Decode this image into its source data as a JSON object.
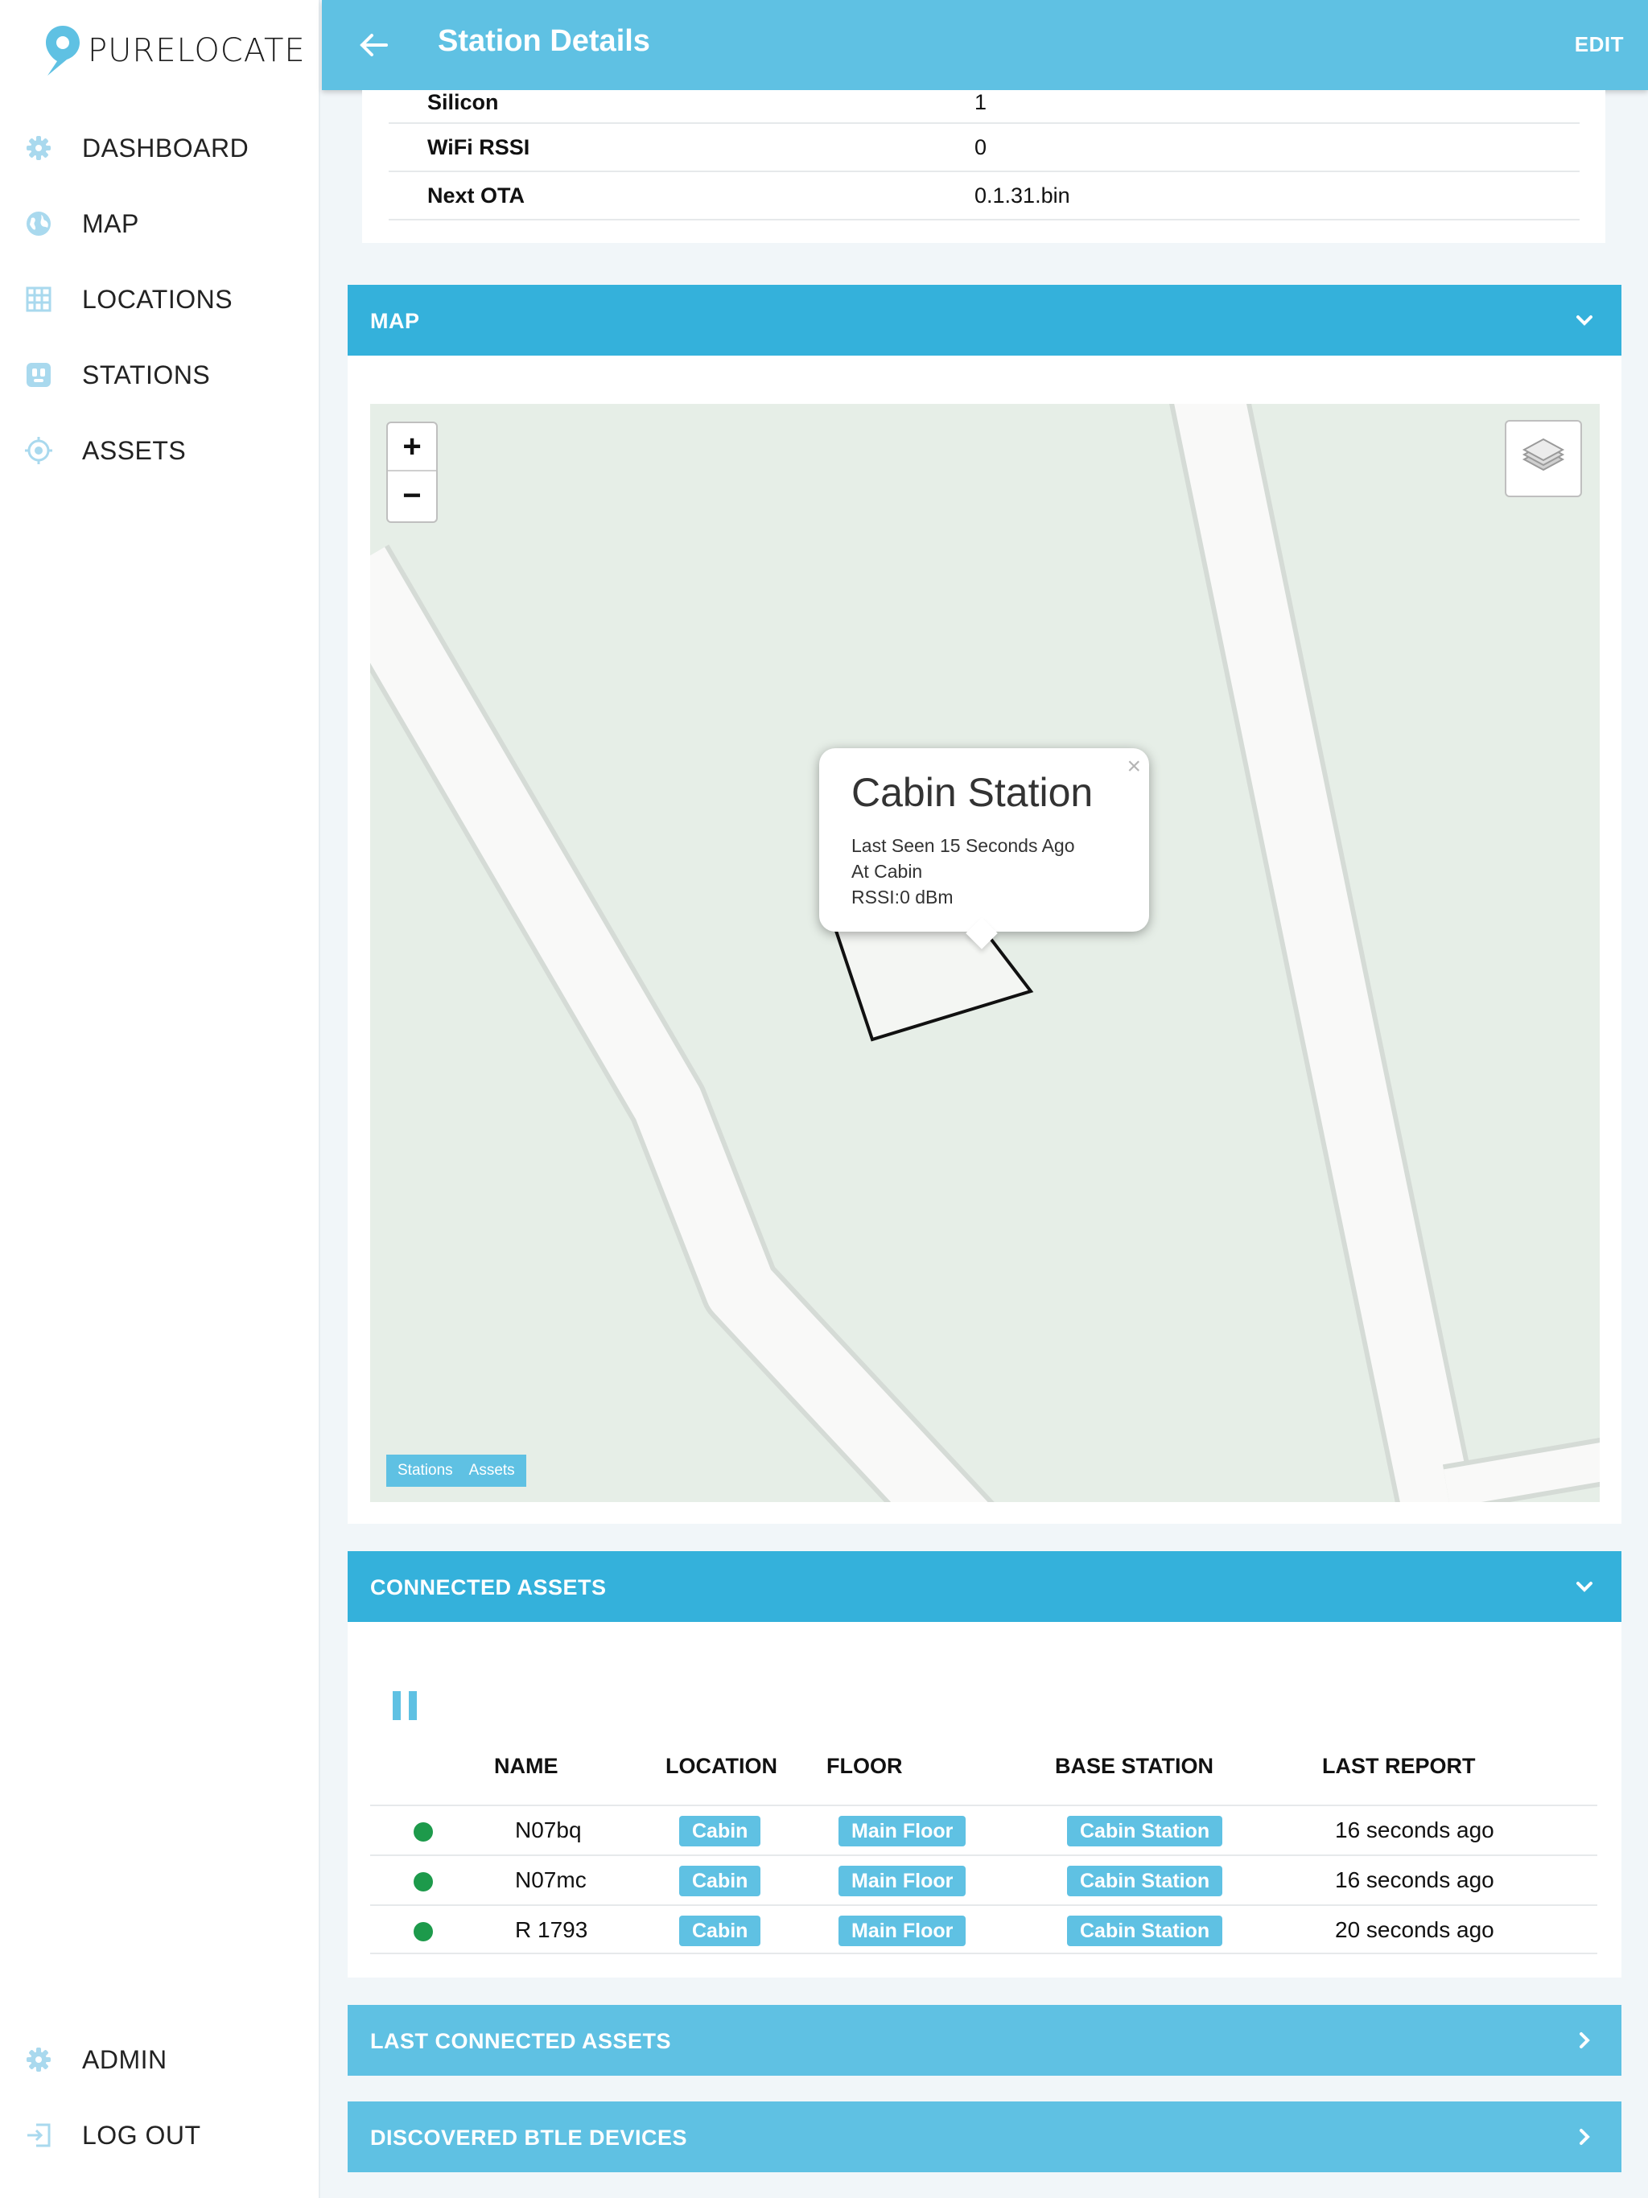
{
  "app": {
    "name": "PURELOCATE"
  },
  "header": {
    "title": "Station Details",
    "edit_label": "EDIT"
  },
  "nav": {
    "items": [
      {
        "label": "DASHBOARD",
        "icon": "gear-icon"
      },
      {
        "label": "MAP",
        "icon": "globe-icon"
      },
      {
        "label": "LOCATIONS",
        "icon": "grid-icon"
      },
      {
        "label": "STATIONS",
        "icon": "station-icon"
      },
      {
        "label": "ASSETS",
        "icon": "target-icon"
      }
    ],
    "bottom": [
      {
        "label": "ADMIN",
        "icon": "gear-icon"
      },
      {
        "label": "LOG OUT",
        "icon": "logout-icon"
      }
    ]
  },
  "info": [
    {
      "key": "Silicon",
      "value": "1"
    },
    {
      "key": "WiFi RSSI",
      "value": "0"
    },
    {
      "key": "Next OTA",
      "value": "0.1.31.bin"
    }
  ],
  "map_panel": {
    "title": "MAP",
    "popup": {
      "title": "Cabin Station",
      "line1": "Last Seen 15 Seconds Ago",
      "line2": "At Cabin",
      "line3": "RSSI:0 dBm"
    },
    "legend": [
      "Stations",
      "Assets"
    ]
  },
  "connected_assets": {
    "title": "CONNECTED ASSETS",
    "columns": [
      "NAME",
      "LOCATION",
      "FLOOR",
      "BASE STATION",
      "LAST REPORT"
    ],
    "rows": [
      {
        "name": "N07bq",
        "location": "Cabin",
        "floor": "Main Floor",
        "base_station": "Cabin Station",
        "last_report": "16 seconds ago"
      },
      {
        "name": "N07mc",
        "location": "Cabin",
        "floor": "Main Floor",
        "base_station": "Cabin Station",
        "last_report": "16 seconds ago"
      },
      {
        "name": "R 1793",
        "location": "Cabin",
        "floor": "Main Floor",
        "base_station": "Cabin Station",
        "last_report": "20 seconds ago"
      }
    ]
  },
  "last_connected_assets": {
    "title": "LAST CONNECTED ASSETS"
  },
  "discovered_btle": {
    "title": "DISCOVERED BTLE DEVICES"
  },
  "colors": {
    "accent": "#34b1db",
    "accent_light": "#5fc1e3",
    "status_online": "#1d9a4b",
    "icon_tint": "#a9d9ee"
  }
}
